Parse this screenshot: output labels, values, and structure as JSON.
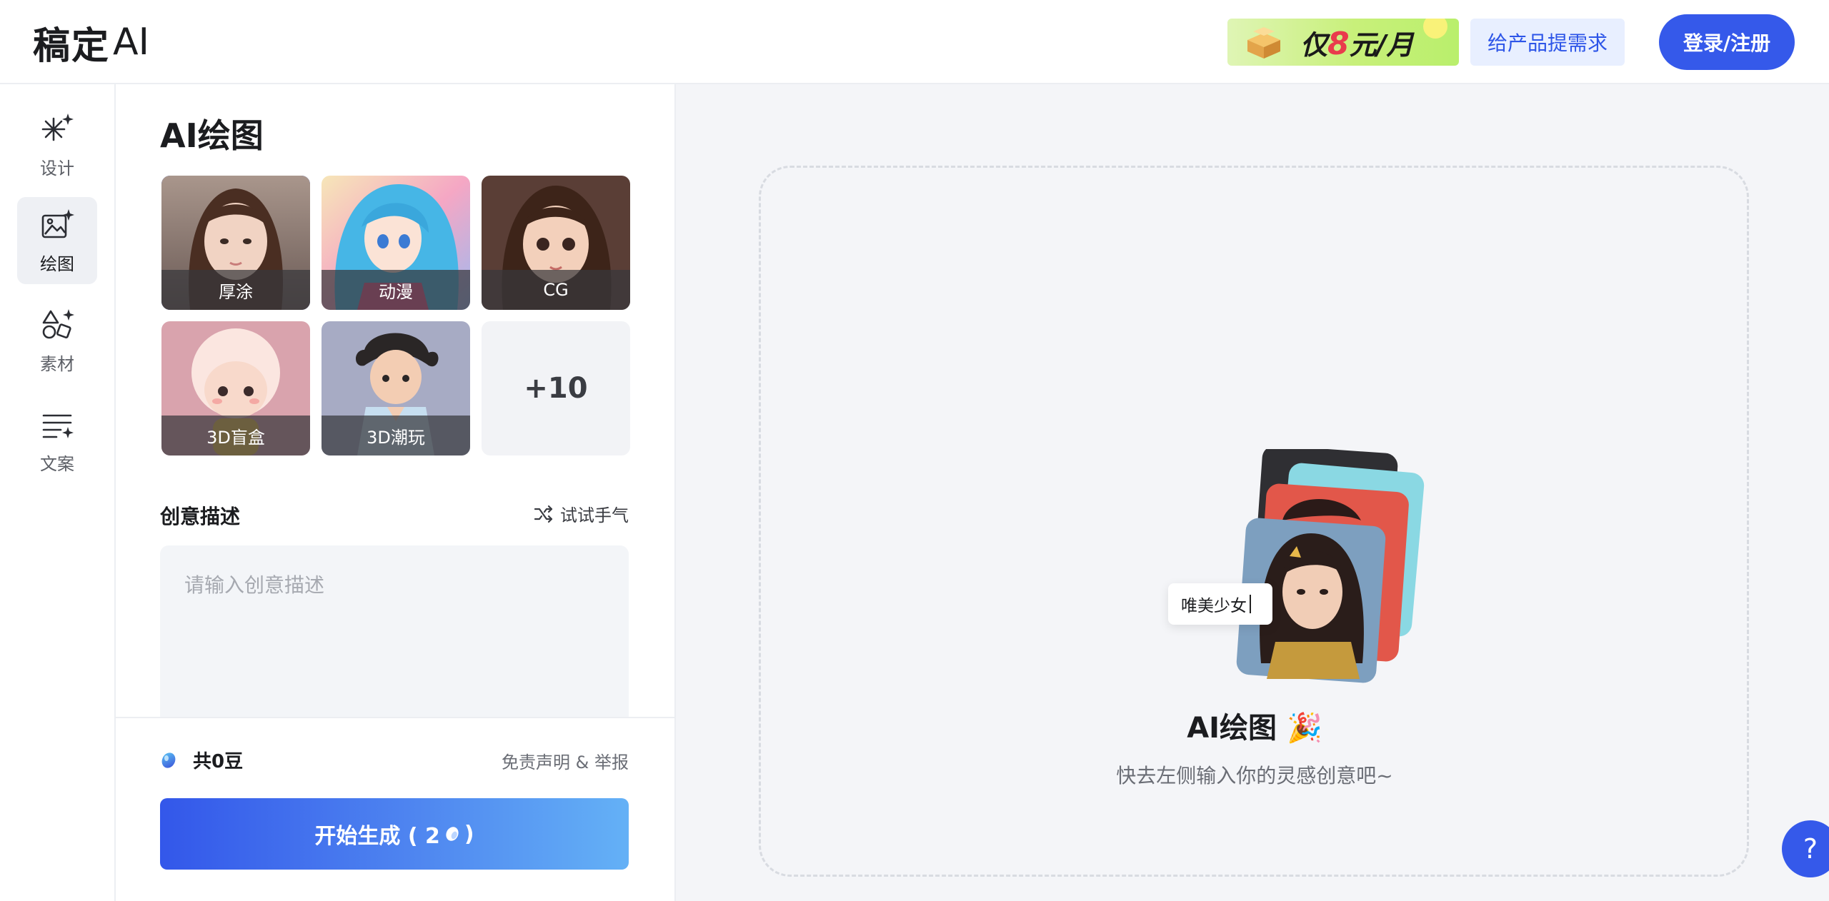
{
  "app": {
    "logo_text": "稿定",
    "logo_ai": "AI"
  },
  "header": {
    "promo": {
      "prefix": "仅",
      "number": "8",
      "suffix": "元/月"
    },
    "feedback_label": "给产品提需求",
    "login_label": "登录/注册"
  },
  "sidenav": {
    "items": [
      {
        "label": "设计",
        "icon": "magic-sparkle-icon",
        "active": false
      },
      {
        "label": "绘图",
        "icon": "image-sparkle-icon",
        "active": true
      },
      {
        "label": "素材",
        "icon": "shapes-sparkle-icon",
        "active": false
      },
      {
        "label": "文案",
        "icon": "text-sparkle-icon",
        "active": false
      }
    ]
  },
  "panel": {
    "title": "AI绘图",
    "styles": [
      {
        "label": "厚涂",
        "selected": true
      },
      {
        "label": "动漫",
        "selected": false
      },
      {
        "label": "CG",
        "selected": false
      },
      {
        "label": "3D盲盒",
        "selected": false
      },
      {
        "label": "3D潮玩",
        "selected": false
      }
    ],
    "more_label": "+10",
    "desc_label": "创意描述",
    "try_luck_label": "试试手气",
    "desc_placeholder": "请输入创意描述",
    "desc_value": ""
  },
  "footer": {
    "beans_label": "共0豆",
    "disclaimer": "免责声明 & 举报",
    "generate_label": "开始生成 ( 2",
    "generate_suffix": ")"
  },
  "preview": {
    "prompt_chip": "唯美少女",
    "title": "AI绘图 🎉",
    "subtitle": "快去左侧输入你的灵感创意吧~",
    "help_label": "?"
  },
  "colors": {
    "accent": "#3559ea",
    "panel_bg": "#f4f5f8"
  }
}
